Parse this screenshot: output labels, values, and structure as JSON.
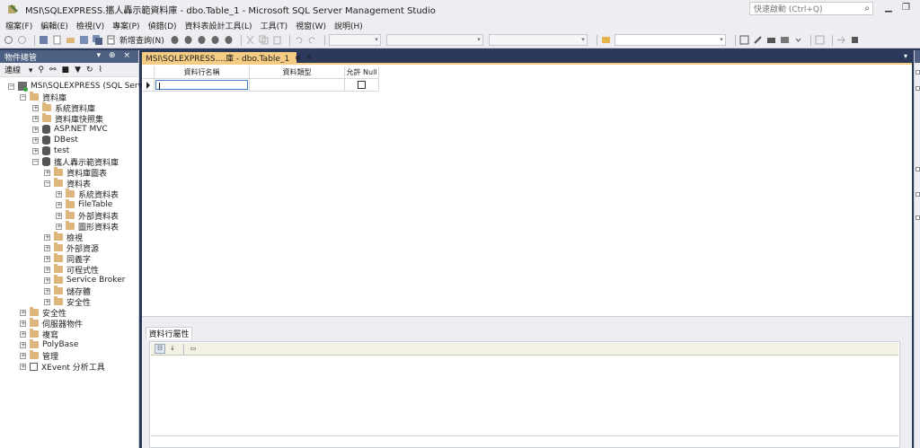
{
  "window": {
    "title": "MSI\\SQLEXPRESS.攜人轟示範資料庫 - dbo.Table_1 - Microsoft SQL Server Management Studio",
    "quick_launch_placeholder": "快速啟動 (Ctrl+Q)"
  },
  "menu": [
    "檔案(F)",
    "編輯(E)",
    "檢視(V)",
    "專案(P)",
    "偵錯(D)",
    "資料表設計工具(L)",
    "工具(T)",
    "視窗(W)",
    "說明(H)"
  ],
  "toolbar": {
    "new_query_label": "新增查詢(N)"
  },
  "object_explorer": {
    "title": "物件總管",
    "connect_label": "連線",
    "tree": [
      {
        "label": "MSI\\SQLEXPRESS (SQL Server",
        "level": 0,
        "icon": "server-icon",
        "exp": "−"
      },
      {
        "label": "資料庫",
        "level": 1,
        "icon": "folder-icon",
        "exp": "−"
      },
      {
        "label": "系統資料庫",
        "level": 2,
        "icon": "folder-icon",
        "exp": "+"
      },
      {
        "label": "資料庫快照集",
        "level": 2,
        "icon": "folder-icon",
        "exp": "+"
      },
      {
        "label": "ASP.NET MVC",
        "level": 2,
        "icon": "database-icon",
        "exp": "+"
      },
      {
        "label": "DBest",
        "level": 2,
        "icon": "database-icon",
        "exp": "+"
      },
      {
        "label": "test",
        "level": 2,
        "icon": "database-icon",
        "exp": "+"
      },
      {
        "label": "攜人轟示範資料庫",
        "level": 2,
        "icon": "database-icon",
        "exp": "−"
      },
      {
        "label": "資料庫圖表",
        "level": 3,
        "icon": "folder-icon",
        "exp": "+"
      },
      {
        "label": "資料表",
        "level": 3,
        "icon": "folder-icon",
        "exp": "−"
      },
      {
        "label": "系統資料表",
        "level": 4,
        "icon": "folder-icon",
        "exp": "+"
      },
      {
        "label": "FileTable",
        "level": 4,
        "icon": "folder-icon",
        "exp": "+"
      },
      {
        "label": "外部資料表",
        "level": 4,
        "icon": "folder-icon",
        "exp": "+"
      },
      {
        "label": "圖形資料表",
        "level": 4,
        "icon": "folder-icon",
        "exp": "+"
      },
      {
        "label": "檢視",
        "level": 3,
        "icon": "folder-icon",
        "exp": "+"
      },
      {
        "label": "外部資源",
        "level": 3,
        "icon": "folder-icon",
        "exp": "+"
      },
      {
        "label": "同義字",
        "level": 3,
        "icon": "folder-icon",
        "exp": "+"
      },
      {
        "label": "可程式性",
        "level": 3,
        "icon": "folder-icon",
        "exp": "+"
      },
      {
        "label": "Service Broker",
        "level": 3,
        "icon": "folder-icon",
        "exp": "+"
      },
      {
        "label": "儲存體",
        "level": 3,
        "icon": "folder-icon",
        "exp": "+"
      },
      {
        "label": "安全性",
        "level": 3,
        "icon": "folder-icon",
        "exp": "+"
      },
      {
        "label": "安全性",
        "level": 1,
        "icon": "folder-icon",
        "exp": "+"
      },
      {
        "label": "伺服器物件",
        "level": 1,
        "icon": "folder-icon",
        "exp": "+"
      },
      {
        "label": "複寫",
        "level": 1,
        "icon": "folder-icon",
        "exp": "+"
      },
      {
        "label": "PolyBase",
        "level": 1,
        "icon": "folder-icon",
        "exp": "+"
      },
      {
        "label": "管理",
        "level": 1,
        "icon": "folder-icon",
        "exp": "+"
      },
      {
        "label": "XEvent 分析工具",
        "level": 1,
        "icon": "xevent-icon",
        "exp": "+"
      }
    ]
  },
  "document_tab": {
    "label": "MSI\\SQLEXPRESS....庫 - dbo.Table_1",
    "pin": "⊕",
    "close": "×"
  },
  "designer": {
    "columns": [
      "資料行名稱",
      "資料類型",
      "允許 Null"
    ],
    "row": {
      "name": "",
      "type": "",
      "allow_null": false
    }
  },
  "properties": {
    "tab_label": "資料行屬性"
  }
}
